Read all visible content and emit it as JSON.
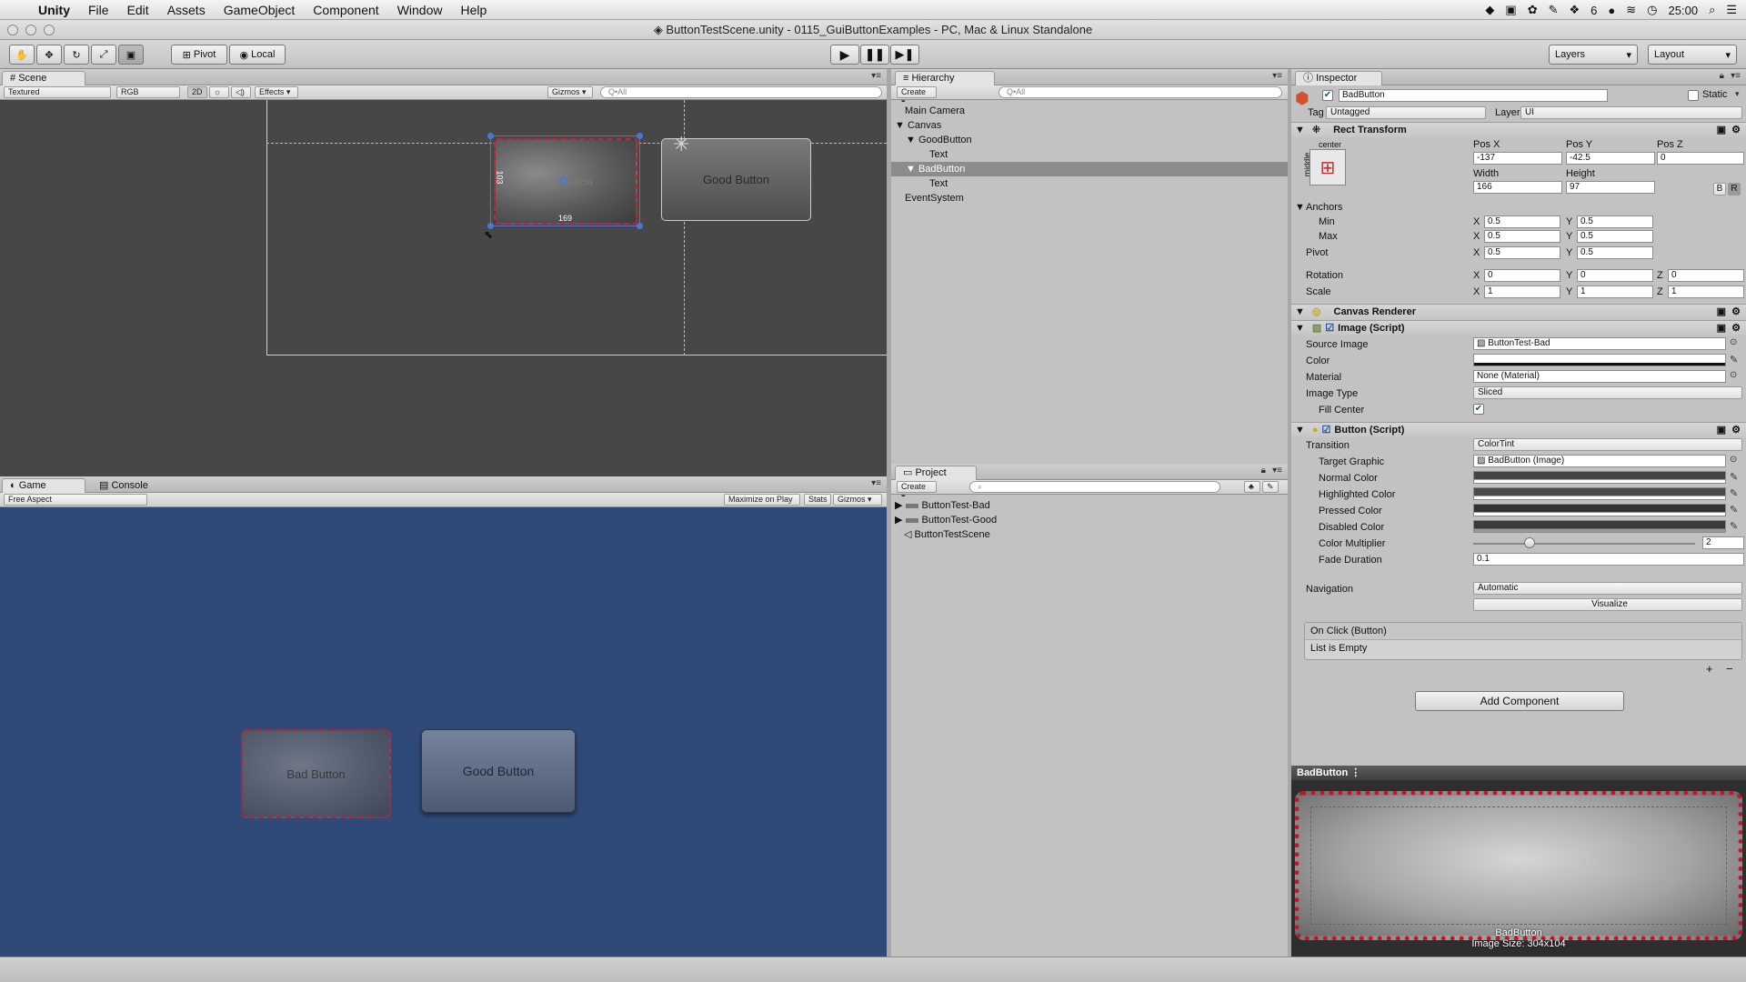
{
  "menubar": {
    "apple": "",
    "app": "Unity",
    "items": [
      "File",
      "Edit",
      "Assets",
      "GameObject",
      "Component",
      "Window",
      "Help"
    ],
    "tray_num": "6",
    "clock": "25:00"
  },
  "window": {
    "title": "ButtonTestScene.unity - 0115_GuiButtonExamples - PC, Mac & Linux Standalone"
  },
  "toolbar": {
    "pivot": "Pivot",
    "local": "Local",
    "layers": "Layers",
    "layout": "Layout"
  },
  "scene": {
    "tab": "Scene",
    "render_mode": "Textured",
    "color_mode": "RGB",
    "mode_2d": "2D",
    "effects": "Effects",
    "gizmos": "Gizmos",
    "search_placeholder": "Q•All",
    "bad_button": "Bad Button",
    "good_button": "Good Button",
    "height_readout": "103",
    "width_readout": "169"
  },
  "game": {
    "tab": "Game",
    "console_tab": "Console",
    "aspect": "Free Aspect",
    "maximize": "Maximize on Play",
    "stats": "Stats",
    "gizmos": "Gizmos",
    "bad_button": "Bad Button",
    "good_button": "Good Button"
  },
  "hierarchy": {
    "tab": "Hierarchy",
    "create": "Create",
    "search_placeholder": "Q•All",
    "items": [
      {
        "label": "Main Camera"
      },
      {
        "label": "Canvas"
      },
      {
        "label": "GoodButton"
      },
      {
        "label": "Text"
      },
      {
        "label": "BadButton"
      },
      {
        "label": "Text"
      },
      {
        "label": "EventSystem"
      }
    ]
  },
  "project": {
    "tab": "Project",
    "create": "Create",
    "items": [
      {
        "label": "ButtonTest-Bad"
      },
      {
        "label": "ButtonTest-Good"
      },
      {
        "label": "ButtonTestScene"
      }
    ]
  },
  "inspector": {
    "tab": "Inspector",
    "object_name": "BadButton",
    "static": "Static",
    "tag_label": "Tag",
    "tag_value": "Untagged",
    "layer_label": "Layer",
    "layer_value": "UI",
    "rect_transform": {
      "title": "Rect Transform",
      "anchor_top": "center",
      "anchor_side": "middle",
      "posx_label": "Pos X",
      "posx": "-137",
      "posy_label": "Pos Y",
      "posy": "-42.5",
      "posz_label": "Pos Z",
      "posz": "0",
      "width_label": "Width",
      "width": "166",
      "height_label": "Height",
      "height": "97",
      "blueprint": "B",
      "raw": "R",
      "anchors_label": "Anchors",
      "min_label": "Min",
      "min_x": "0.5",
      "min_y": "0.5",
      "max_label": "Max",
      "max_x": "0.5",
      "max_y": "0.5",
      "pivot_label": "Pivot",
      "pivot_x": "0.5",
      "pivot_y": "0.5",
      "rotation_label": "Rotation",
      "rot_x": "0",
      "rot_y": "0",
      "rot_z": "0",
      "scale_label": "Scale",
      "scale_x": "1",
      "scale_y": "1",
      "scale_z": "1",
      "x": "X",
      "y": "Y",
      "z": "Z"
    },
    "canvas_renderer": "Canvas Renderer",
    "image_script": {
      "title": "Image (Script)",
      "source_label": "Source Image",
      "source": "ButtonTest-Bad",
      "color_label": "Color",
      "material_label": "Material",
      "material": "None (Material)",
      "type_label": "Image Type",
      "type": "Sliced",
      "fill_label": "Fill Center"
    },
    "button_script": {
      "title": "Button (Script)",
      "transition_label": "Transition",
      "transition": "ColorTint",
      "target_label": "Target Graphic",
      "target": "BadButton (Image)",
      "normal_label": "Normal Color",
      "highlighted_label": "Highlighted Color",
      "pressed_label": "Pressed Color",
      "disabled_label": "Disabled Color",
      "multiplier_label": "Color Multiplier",
      "multiplier": "2",
      "fade_label": "Fade Duration",
      "fade": "0.1",
      "nav_label": "Navigation",
      "nav": "Automatic",
      "visualize": "Visualize",
      "onclick": "On Click (Button)",
      "list_empty": "List is Empty",
      "plus": "+",
      "minus": "−"
    },
    "add_component": "Add Component",
    "preview": {
      "title": "BadButton",
      "name": "BadButton",
      "size": "Image Size: 304x104"
    }
  },
  "colors": {
    "scene_bg": "#474747",
    "game_bg": "#2f4a78",
    "panel_bg": "#c2c2c2",
    "selection": "#8c8c8c",
    "bad_border": "#b3233f",
    "preview_border": "#d0102a"
  }
}
